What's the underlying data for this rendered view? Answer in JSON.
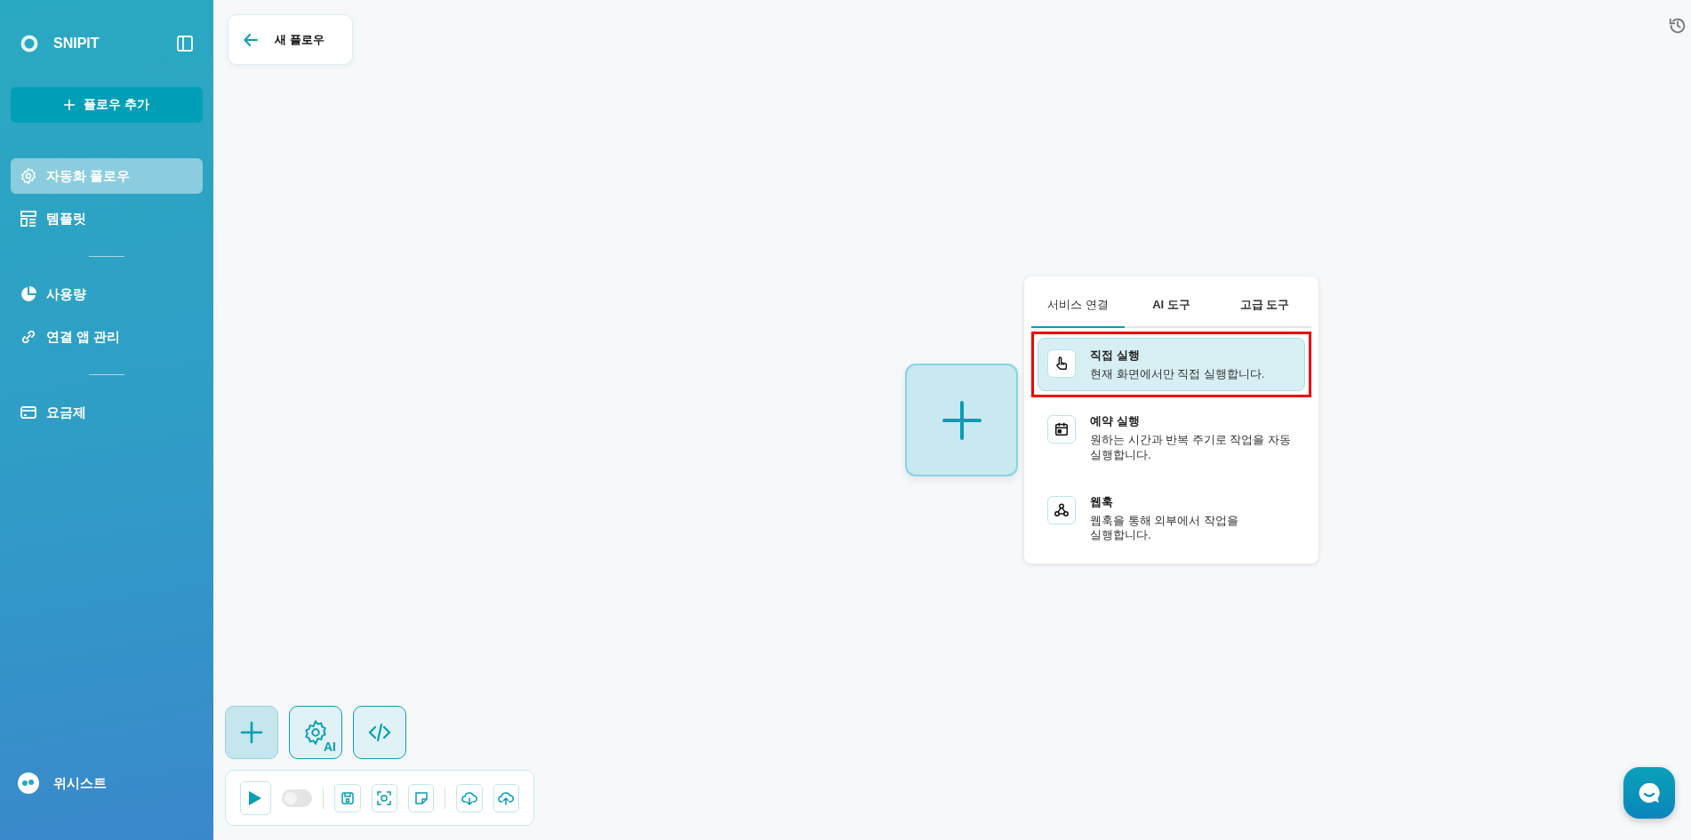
{
  "sidebar": {
    "brand": "SNIPIT",
    "add_button": "플로우 추가",
    "groups": [
      [
        {
          "label": "자동화 플로우",
          "kind": "gear",
          "selected": true
        },
        {
          "label": "템플릿",
          "kind": "template",
          "selected": false
        }
      ],
      [
        {
          "label": "사용량",
          "kind": "pie",
          "selected": false
        },
        {
          "label": "연결 앱 관리",
          "kind": "link",
          "selected": false
        }
      ],
      [
        {
          "label": "요금제",
          "kind": "card",
          "selected": false
        }
      ]
    ],
    "footer": "위시스트"
  },
  "header": {
    "title": "새 플로우"
  },
  "popup": {
    "tabs": [
      {
        "label": "서비스 연결",
        "selected": true
      },
      {
        "label": "AI 도구",
        "selected": false
      },
      {
        "label": "고급 도구",
        "selected": false
      }
    ],
    "options": [
      {
        "title": "직접 실행",
        "description": "현재 화면에서만 직접 실행합니다.",
        "kind": "hand",
        "selected": true,
        "highlighted": true
      },
      {
        "title": "예약 실행",
        "description": "원하는 시간과 반복 주기로 작업을 자동 실행합니다.",
        "kind": "calendar",
        "selected": false,
        "highlighted": false
      },
      {
        "title": "웹훅",
        "description": "웹훅을 통해 외부에서 작업을 실행합니다.",
        "kind": "webhook",
        "selected": false,
        "highlighted": false
      }
    ]
  },
  "dock": {
    "ai_badge": "AI"
  },
  "toolbar": {
    "toggle": {
      "on": false
    }
  }
}
